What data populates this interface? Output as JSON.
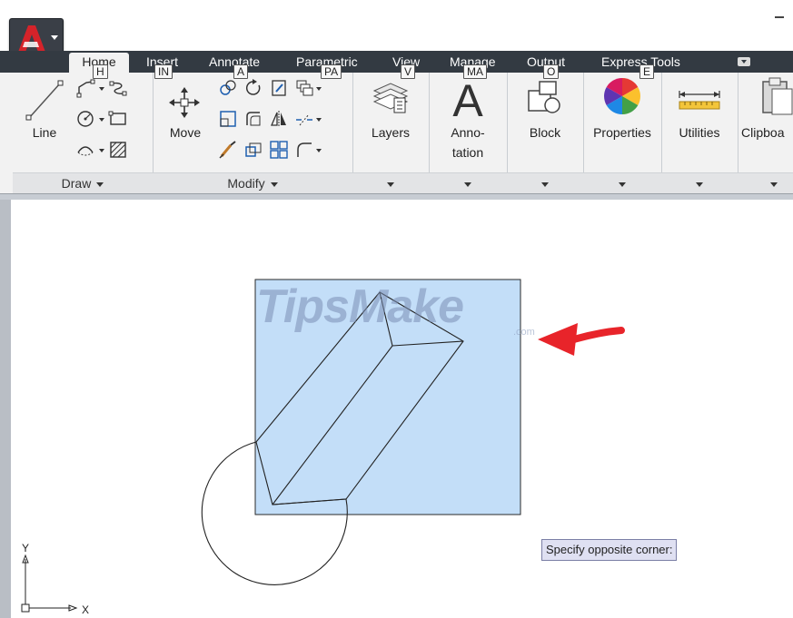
{
  "ribbon": {
    "tabs": [
      {
        "label": "Home",
        "keytip": "H",
        "active": true
      },
      {
        "label": "Insert",
        "keytip": "IN"
      },
      {
        "label": "Annotate",
        "keytip": "A"
      },
      {
        "label": "Parametric",
        "keytip": "PA"
      },
      {
        "label": "View",
        "keytip": "V"
      },
      {
        "label": "Manage",
        "keytip": "MA"
      },
      {
        "label": "Output",
        "keytip": "O"
      },
      {
        "label": "Express Tools",
        "keytip": "E"
      }
    ],
    "panels": {
      "draw": {
        "title": "Draw",
        "line_label": "Line"
      },
      "modify": {
        "title": "Modify",
        "move_label": "Move"
      },
      "layers": {
        "label": "Layers"
      },
      "annotation": {
        "label_line1": "Anno-",
        "label_line2": "tation"
      },
      "block": {
        "label": "Block"
      },
      "properties": {
        "label": "Properties"
      },
      "utilities": {
        "label": "Utilities"
      },
      "clipboard": {
        "label": "Clipboa"
      }
    }
  },
  "canvas": {
    "tooltip": "Specify opposite corner:",
    "ucs": {
      "x": "X",
      "y": "Y"
    },
    "selection_fill": "#c3def8",
    "arrow_color": "#e8242a"
  },
  "watermark": {
    "text": "TipsMake",
    "suffix": ".com"
  }
}
